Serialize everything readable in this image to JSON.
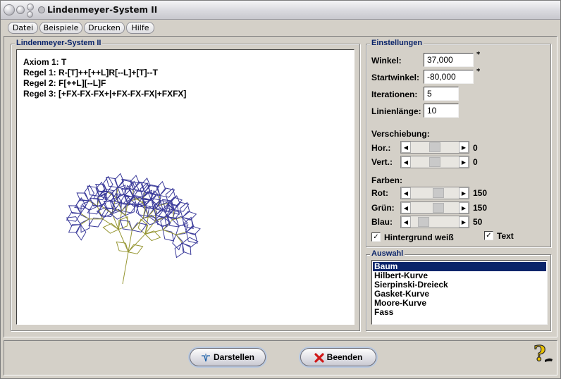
{
  "window": {
    "title": "Lindenmeyer-System II"
  },
  "menu": [
    "Datei",
    "Beispiele",
    "Drucken",
    "Hilfe"
  ],
  "drawing_panel": {
    "title": "Lindenmeyer-System II",
    "rules": [
      {
        "label": "Axiom 1:",
        "value": "T"
      },
      {
        "label": "Regel 1:",
        "value": "R-[T]++[++L]R[--L]+[T]--T"
      },
      {
        "label": "Regel 2:",
        "value": "F[++L][--L]F"
      },
      {
        "label": "Regel 3:",
        "value": "[+FX-FX-FX+|+FX-FX-FX|+FXFX]"
      }
    ]
  },
  "settings": {
    "title": "Einstellungen",
    "winkel": {
      "label": "Winkel:",
      "value": "37,000",
      "mark": "*"
    },
    "startwinkel": {
      "label": "Startwinkel:",
      "value": "-80,000",
      "mark": "*"
    },
    "iterationen": {
      "label": "Iterationen:",
      "value": "5"
    },
    "linienlaenge": {
      "label": "Linienlänge:",
      "value": "10"
    },
    "verschiebung": {
      "label": "Verschiebung:",
      "hor": {
        "label": "Hor.:",
        "value": "0",
        "thumb_fraction": 0.5
      },
      "vert": {
        "label": "Vert.:",
        "value": "0",
        "thumb_fraction": 0.5
      }
    },
    "farben": {
      "label": "Farben:",
      "rot": {
        "label": "Rot:",
        "value": "150",
        "thumb_fraction": 0.59
      },
      "gruen": {
        "label": "Grün:",
        "value": "150",
        "thumb_fraction": 0.59
      },
      "blau": {
        "label": "Blau:",
        "value": "50",
        "thumb_fraction": 0.2
      }
    },
    "hintergrund_weiss": {
      "label": "Hintergrund weiß",
      "checked": true
    },
    "text": {
      "label": "Text",
      "checked": true
    }
  },
  "selection": {
    "title": "Auswahl",
    "items": [
      "Baum",
      "Hilbert-Kurve",
      "Sierpinski-Dreieck",
      "Gasket-Kurve",
      "Moore-Kurve",
      "Fass"
    ],
    "selected": "Baum"
  },
  "buttons": {
    "darstellen": "Darstellen",
    "beenden": "Beenden"
  },
  "colors": {
    "tree_stem": "#969632",
    "tree_leaf": "#3a3a9a",
    "selection": "#0a246a"
  },
  "icons": {
    "darstellen": "plot-icon",
    "beenden": "red-x-icon",
    "help": "question-mark-icon"
  }
}
